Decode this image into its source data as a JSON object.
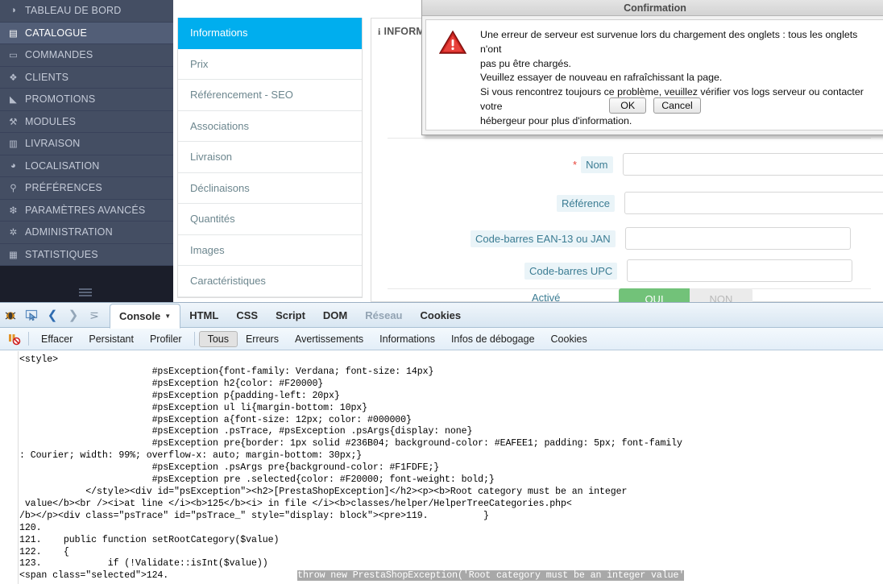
{
  "sidebar": {
    "items": [
      {
        "label": "TABLEAU DE BORD",
        "icon": "dashboard-icon",
        "glyph": "◑",
        "active": false
      },
      {
        "label": "CATALOGUE",
        "icon": "book-icon",
        "glyph": "▤",
        "active": true
      },
      {
        "label": "COMMANDES",
        "icon": "card-icon",
        "glyph": "▭",
        "active": false
      },
      {
        "label": "CLIENTS",
        "icon": "users-icon",
        "glyph": "❖",
        "active": false
      },
      {
        "label": "PROMOTIONS",
        "icon": "tag-icon",
        "glyph": "◣",
        "active": false
      },
      {
        "label": "MODULES",
        "icon": "puzzle-icon",
        "glyph": "⚒",
        "active": false
      },
      {
        "label": "LIVRAISON",
        "icon": "truck-icon",
        "glyph": "▥",
        "active": false
      },
      {
        "label": "LOCALISATION",
        "icon": "globe-icon",
        "glyph": "◕",
        "active": false
      },
      {
        "label": "PRÉFÉRENCES",
        "icon": "wrench-icon",
        "glyph": "⚲",
        "active": false
      },
      {
        "label": "PARAMÈTRES AVANCÉS",
        "icon": "cogs-icon",
        "glyph": "❇",
        "active": false
      },
      {
        "label": "ADMINISTRATION",
        "icon": "gear-icon",
        "glyph": "✲",
        "active": false
      },
      {
        "label": "STATISTIQUES",
        "icon": "chart-icon",
        "glyph": "▦",
        "active": false
      }
    ],
    "collapse_icon": "hamburger-icon"
  },
  "product_tabs": [
    {
      "label": "Informations",
      "active": true
    },
    {
      "label": "Prix",
      "active": false
    },
    {
      "label": "Référencement - SEO",
      "active": false
    },
    {
      "label": "Associations",
      "active": false
    },
    {
      "label": "Livraison",
      "active": false
    },
    {
      "label": "Déclinaisons",
      "active": false
    },
    {
      "label": "Quantités",
      "active": false
    },
    {
      "label": "Images",
      "active": false
    },
    {
      "label": "Caractéristiques",
      "active": false
    }
  ],
  "form": {
    "panel_title": "INFORM",
    "panel_title_icon": "info-icon",
    "required_marker": "*",
    "fields": [
      {
        "label": "Nom",
        "value": "",
        "required": true
      },
      {
        "label": "Référence",
        "value": "",
        "required": false
      },
      {
        "label": "Code-barres EAN-13 ou JAN",
        "value": "",
        "required": false
      },
      {
        "label": "Code-barres UPC",
        "value": "",
        "required": false
      }
    ],
    "switch": {
      "label": "Activé",
      "yes": "OUI",
      "no": "NON"
    }
  },
  "modal": {
    "title": "Confirmation",
    "icon": "warning-triangle-icon",
    "message_lines": [
      "Une erreur de serveur est survenue lors du chargement des onglets : tous les onglets n'ont",
      "pas pu être chargés.",
      "Veuillez essayer de nouveau en rafraîchissant la page.",
      "Si vous rencontrez toujours ce problème, veuillez vérifier vos logs serveur ou contacter votre",
      "hébergeur pour plus d'information."
    ],
    "buttons": [
      {
        "label": "OK"
      },
      {
        "label": "Cancel"
      }
    ]
  },
  "firebug": {
    "icons": [
      {
        "name": "firebug-logo-icon",
        "glyph": "🐞"
      },
      {
        "name": "inspect-cursor-icon",
        "glyph": "⬚"
      },
      {
        "name": "back-arrow-icon",
        "glyph": "❮"
      },
      {
        "name": "forward-arrow-icon",
        "glyph": "❯"
      },
      {
        "name": "command-line-icon",
        "glyph": "⋗"
      }
    ],
    "tabs": [
      {
        "label": "Console",
        "active": true,
        "dim": false,
        "has_caret": true
      },
      {
        "label": "HTML",
        "active": false,
        "dim": false,
        "has_caret": false
      },
      {
        "label": "CSS",
        "active": false,
        "dim": false,
        "has_caret": false
      },
      {
        "label": "Script",
        "active": false,
        "dim": false,
        "has_caret": false
      },
      {
        "label": "DOM",
        "active": false,
        "dim": false,
        "has_caret": false
      },
      {
        "label": "Réseau",
        "active": false,
        "dim": true,
        "has_caret": false
      },
      {
        "label": "Cookies",
        "active": false,
        "dim": false,
        "has_caret": false
      }
    ],
    "filter_icon": "clear-console-icon",
    "actions": [
      {
        "label": "Effacer",
        "selected": false
      },
      {
        "label": "Persistant",
        "selected": false
      },
      {
        "label": "Profiler",
        "selected": false
      }
    ],
    "filters": [
      {
        "label": "Tous",
        "selected": true
      },
      {
        "label": "Erreurs",
        "selected": false
      },
      {
        "label": "Avertissements",
        "selected": false
      },
      {
        "label": "Informations",
        "selected": false
      },
      {
        "label": "Infos de débogage",
        "selected": false
      },
      {
        "label": "Cookies",
        "selected": false
      }
    ],
    "console_output": "<style>\n                        #psException{font-family: Verdana; font-size: 14px}\n                        #psException h2{color: #F20000}\n                        #psException p{padding-left: 20px}\n                        #psException ul li{margin-bottom: 10px}\n                        #psException a{font-size: 12px; color: #000000}\n                        #psException .psTrace, #psException .psArgs{display: none}\n                        #psException pre{border: 1px solid #236B04; background-color: #EAFEE1; padding: 5px; font-family\n: Courier; width: 99%; overflow-x: auto; margin-bottom: 30px;}\n                        #psException .psArgs pre{background-color: #F1FDFE;}\n                        #psException pre .selected{color: #F20000; font-weight: bold;}\n            </style><div id=\"psException\"><h2>[PrestaShopException]</h2><p><b>Root category must be an integer\n value</b><br /><i>at line </i><b>125</b><i> in file </i><b>classes/helper/HelperTreeCategories.php<\n/b></p><div class=\"psTrace\" id=\"psTrace_\" style=\"display: block\"><pre>119.          }\n120.\n121.    public function setRootCategory($value)\n122.    {\n123.            if (!Validate::isInt($value))",
    "console_last_line_prefix": "<span class=\"selected\">124.",
    "console_last_line_selected": "throw new PrestaShopException('Root category must be an integer value'"
  }
}
